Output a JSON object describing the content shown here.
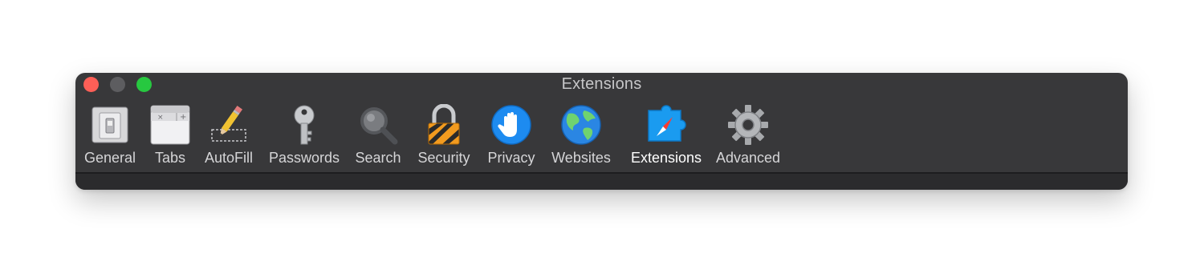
{
  "window": {
    "title": "Extensions"
  },
  "toolbar": {
    "items": [
      {
        "label": "General",
        "icon": "general-switch-icon"
      },
      {
        "label": "Tabs",
        "icon": "tabs-icon"
      },
      {
        "label": "AutoFill",
        "icon": "pencil-icon"
      },
      {
        "label": "Passwords",
        "icon": "key-icon"
      },
      {
        "label": "Search",
        "icon": "magnifier-icon"
      },
      {
        "label": "Security",
        "icon": "padlock-icon"
      },
      {
        "label": "Privacy",
        "icon": "hand-icon"
      },
      {
        "label": "Websites",
        "icon": "globe-icon"
      },
      {
        "label": "Extensions",
        "icon": "puzzle-compass-icon",
        "selected": true
      },
      {
        "label": "Advanced",
        "icon": "gear-icon"
      }
    ]
  },
  "colors": {
    "window_bg": "#38383a",
    "highlight_ring": "#f07a8c",
    "close": "#fe5f57",
    "minimize": "#5d5d60",
    "zoom": "#27c840"
  }
}
